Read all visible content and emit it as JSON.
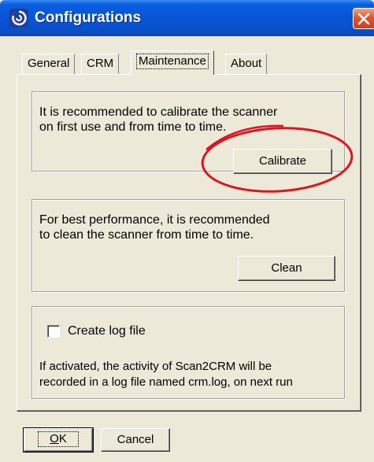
{
  "window": {
    "title": "Configurations"
  },
  "tabs": [
    {
      "label": "General",
      "active": false
    },
    {
      "label": "CRM",
      "active": false
    },
    {
      "label": "Maintenance",
      "active": true
    },
    {
      "label": "About",
      "active": false
    }
  ],
  "calibrate_section": {
    "line1": "It is recommended to calibrate the scanner",
    "line2": "on first use and from time to time.",
    "button_label": "Calibrate"
  },
  "clean_section": {
    "line1": "For best performance, it is recommended",
    "line2": "to clean the scanner from time to time.",
    "button_label": "Clean"
  },
  "log_section": {
    "checkbox_label": "Create log file",
    "checked": false,
    "line1": "If activated, the activity of Scan2CRM will be",
    "line2": "recorded in a log file named crm.log, on next run"
  },
  "footer": {
    "ok_label": "OK",
    "ok_underline": "O",
    "ok_rest": "K",
    "cancel_label": "Cancel"
  },
  "colors": {
    "annotation_circle": "#E0141E",
    "titlebar": "#0854D6",
    "dialog_bg": "#ECE9D8"
  },
  "icons": {
    "app": "app-swirl-icon",
    "close": "close-icon"
  }
}
